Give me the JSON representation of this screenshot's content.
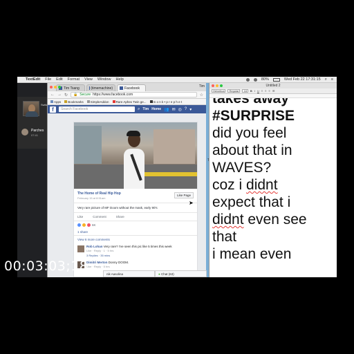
{
  "menubar": {
    "app": "TextEdit",
    "items": [
      "File",
      "Edit",
      "Format",
      "View",
      "Window",
      "Help"
    ],
    "datetime": "Wed Feb 22  17:31:15",
    "battery": "80%"
  },
  "facetime": {
    "switch_label": "Switch Call",
    "caller_name": "Parches",
    "call_time": "07:41",
    "more": "..."
  },
  "browser": {
    "tabs": [
      {
        "label": "Tim Tsang"
      },
      {
        "label": "(timemachine)"
      },
      {
        "label": "Facebook"
      }
    ],
    "profile": "Tim",
    "secure_label": "Secure",
    "url": "https://www.facebook.com",
    "bookmarks": [
      "Apps",
      "Bookmarks",
      "SimpleAddon",
      "Rare Aphex Twin ge...",
      "m o n k • p r e p h e t"
    ],
    "fb": {
      "logo": "f",
      "search_placeholder": "Search Facebook",
      "user": "Tim",
      "home": "Home"
    },
    "post": {
      "page_name": "The Home of Real Hip Hop",
      "date": "February 15 at 8:51am",
      "like_page": "Like Page",
      "caption": "Very rare picture of MF Doom without the mask, early 90's",
      "actions": [
        "Like",
        "Comment",
        "Share"
      ],
      "reactions_count": "6K",
      "shares": "1 share",
      "view_more": "View 6 more comments",
      "comments": [
        {
          "name": "Rob Lohan",
          "text": "Very rare? I've seen this pic like 5 times this week",
          "meta": "Like · Reply · 1 · 5 hrs",
          "replies": "3 Replies · 35 mins"
        },
        {
          "name": "Dimitri Merton",
          "text": "Donny DOOM.",
          "meta": "Like · Reply · 5 hrs",
          "replies": ""
        }
      ]
    },
    "chat": [
      {
        "label": "nik Aasolina"
      },
      {
        "label": "Chat (63)"
      }
    ]
  },
  "textedit": {
    "title": "Untitled 2",
    "toolbar": [
      "Helvetica",
      "Regular",
      "18"
    ],
    "lines": [
      {
        "text": "takes away",
        "bold": true
      },
      {
        "text": "#SURPRISE",
        "bold": true
      },
      {
        "text": "did you feel",
        "bold": false
      },
      {
        "text": "about that in",
        "bold": false
      },
      {
        "text": "WAVES?",
        "bold": false
      },
      {
        "pre": "coz i ",
        "mis": "didnt",
        "post": "",
        "bold": false
      },
      {
        "text": "expect that i",
        "bold": false
      },
      {
        "pre": "",
        "mis": "didnt",
        "post": " even see",
        "bold": false
      },
      {
        "text": "that",
        "bold": false
      },
      {
        "text": "i mean even",
        "bold": false
      }
    ]
  },
  "side_letter": "To",
  "timecode": "00:03:03;18"
}
